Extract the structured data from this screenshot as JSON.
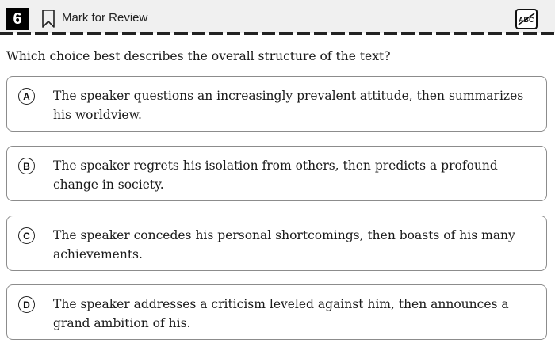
{
  "header": {
    "question_number": "6",
    "mark_label": "Mark for Review",
    "abc_button_icon": "abc-strikethrough-icon"
  },
  "question": {
    "text": "Which choice best describes the overall structure of the text?"
  },
  "choices": [
    {
      "letter": "A",
      "text": "The speaker questions an increasingly prevalent attitude, then summarizes his worldview."
    },
    {
      "letter": "B",
      "text": "The speaker regrets his isolation from others, then predicts a profound change in society."
    },
    {
      "letter": "C",
      "text": "The speaker concedes his personal shortcomings, then boasts of his many achievements."
    },
    {
      "letter": "D",
      "text": "The speaker addresses a criticism leveled against him, then announces a grand ambition of his."
    }
  ]
}
